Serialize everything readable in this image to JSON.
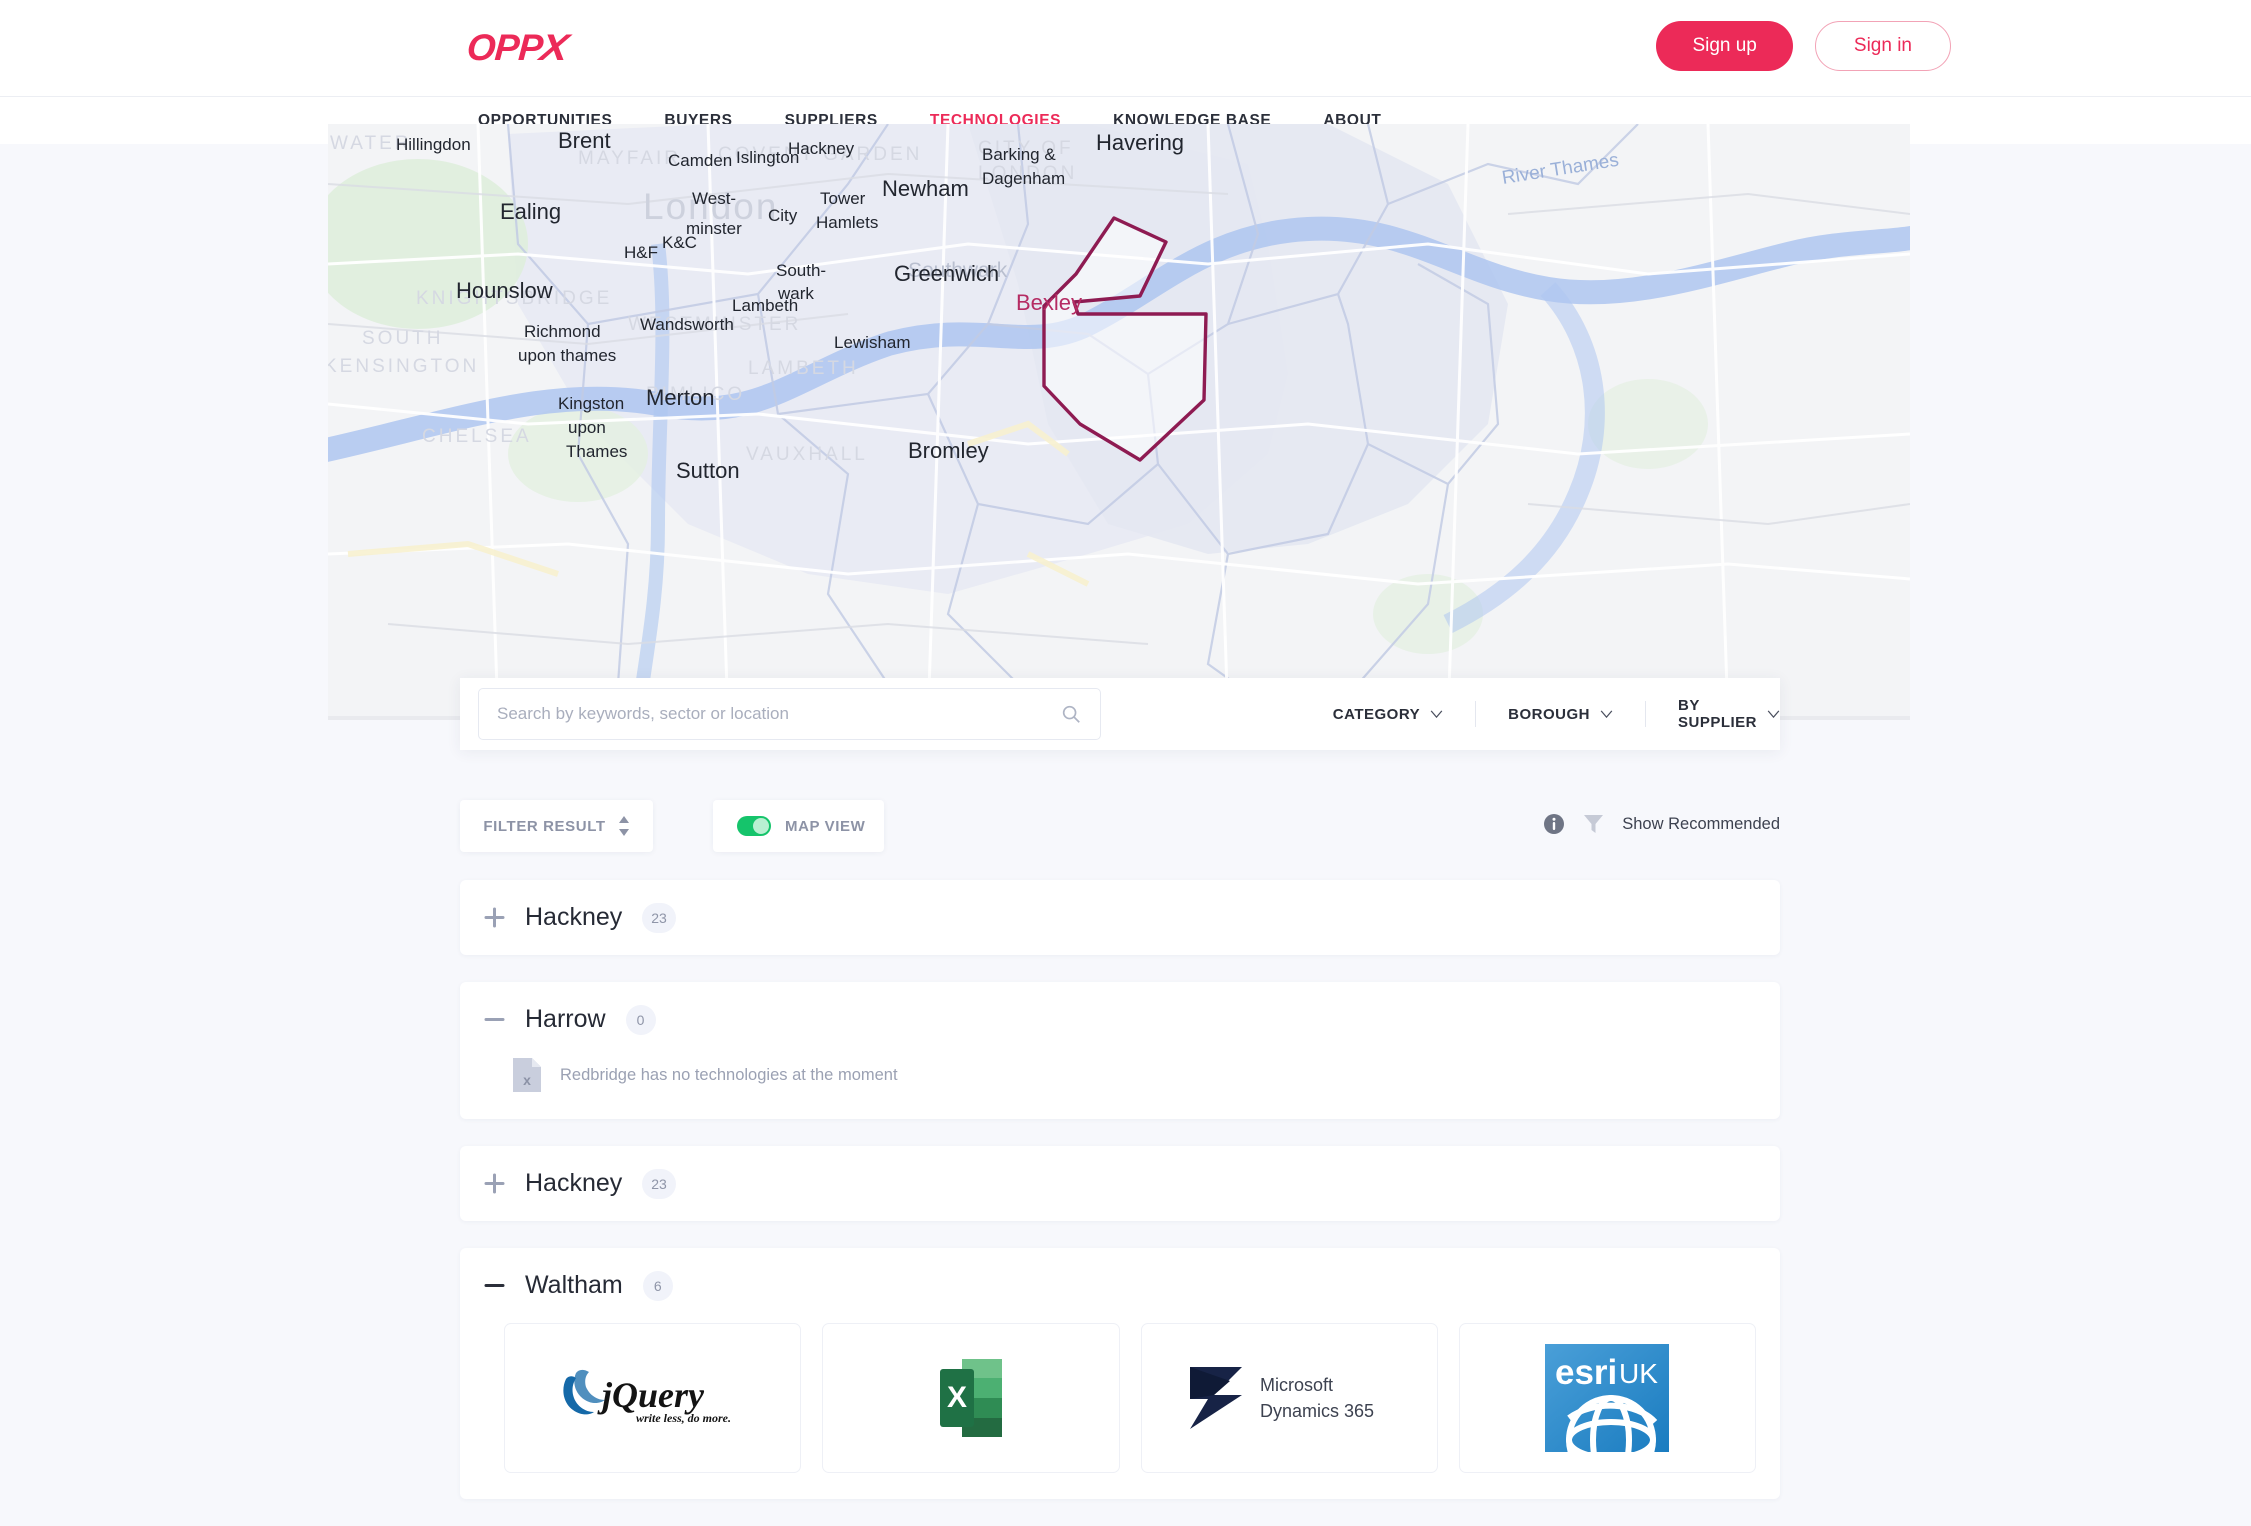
{
  "header": {
    "logo_text": "OPP",
    "logo_accent": "X",
    "brand_color": "#ec2a58",
    "signup_label": "Sign up",
    "signin_label": "Sign in"
  },
  "nav": {
    "items": [
      {
        "label": "OPPORTUNITIES",
        "active": false
      },
      {
        "label": "BUYERS",
        "active": false
      },
      {
        "label": "SUPPLIERS",
        "active": false
      },
      {
        "label": "TECHNOLOGIES",
        "active": true
      },
      {
        "label": "KNOWLEDGE BASE",
        "active": false
      },
      {
        "label": "ABOUT",
        "active": false
      }
    ]
  },
  "map": {
    "highlight_label": "Bexley",
    "highlight_color": "#8e1b52",
    "water_label": "River Thames",
    "borough_labels": [
      "Hillingdon",
      "Brent",
      "Camden",
      "Islington",
      "Hackney",
      "Ealing",
      "West-",
      "minster",
      "City",
      "Tower",
      "Hamlets",
      "Newham",
      "Havering",
      "Barking &",
      "Dagenham",
      "K&C",
      "H&F",
      "South-",
      "wark",
      "Greenwich",
      "Hounslow",
      "Lambeth",
      "Wandsworth",
      "Richmond",
      "upon thames",
      "Lewisham",
      "Kingston",
      "upon",
      "Thames",
      "Merton",
      "Sutton",
      "Bromley"
    ],
    "area_labels": [
      "WATER",
      "MAYFAIR",
      "COVENT GARDEN",
      "CITY OF",
      "LONDON",
      "London",
      "KNIGHTSBRIDGE",
      "SOUTH",
      "KENSINGTON",
      "WESTMINSTER",
      "Southwark",
      "LAMBETH",
      "PIMLICO",
      "CHELSEA",
      "VAUXHALL"
    ]
  },
  "search": {
    "value": "",
    "placeholder": "Search by keywords, sector or location",
    "dropdowns": [
      {
        "label": "CATEGORY"
      },
      {
        "label": "BOROUGH"
      },
      {
        "label": "BY SUPPLIER"
      }
    ]
  },
  "controls": {
    "filter_label": "FILTER RESULT",
    "map_view_label": "MAP VIEW",
    "map_view_on": true,
    "show_recommended_label": "Show Recommended"
  },
  "results": [
    {
      "name": "Hackney",
      "count": "23",
      "expanded": false,
      "empty_message": null,
      "cards": []
    },
    {
      "name": "Harrow",
      "count": "0",
      "expanded": true,
      "empty_message": "Redbridge has no technologies at the moment",
      "cards": []
    },
    {
      "name": "Hackney",
      "count": "23",
      "expanded": false,
      "empty_message": null,
      "cards": []
    },
    {
      "name": "Waltham",
      "count": "6",
      "expanded": true,
      "empty_message": null,
      "cards": [
        {
          "logo": "jquery-logo",
          "name": "jQuery",
          "tagline": "write less, do more."
        },
        {
          "logo": "microsoft-excel-logo",
          "name": "X"
        },
        {
          "logo": "microsoft-dynamics-365-logo",
          "name": "Microsoft",
          "line2": "Dynamics 365"
        },
        {
          "logo": "esri-uk-logo",
          "name": "esri",
          "line2": "UK"
        }
      ]
    }
  ]
}
